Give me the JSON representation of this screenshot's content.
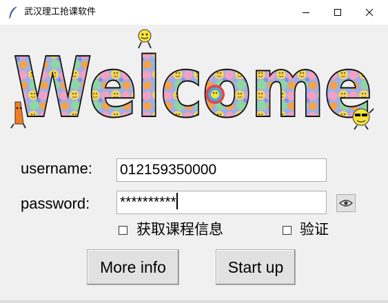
{
  "window": {
    "title": "武汉理工抢课软件"
  },
  "banner": {
    "text": "Welcome"
  },
  "form": {
    "username_label": "username:",
    "username_value": "012159350000",
    "password_label": "password:",
    "password_value": "**********"
  },
  "options": {
    "fetch_course_info_label": "获取课程信息",
    "fetch_course_info_checked": false,
    "verify_label": "验证",
    "verify_checked": false
  },
  "buttons": {
    "more_info": "More info",
    "start_up": "Start up"
  },
  "icons": {
    "app": "feather-icon",
    "show_password": "eye-icon",
    "minimize": "minimize-icon",
    "maximize": "maximize-icon",
    "close": "close-icon"
  }
}
